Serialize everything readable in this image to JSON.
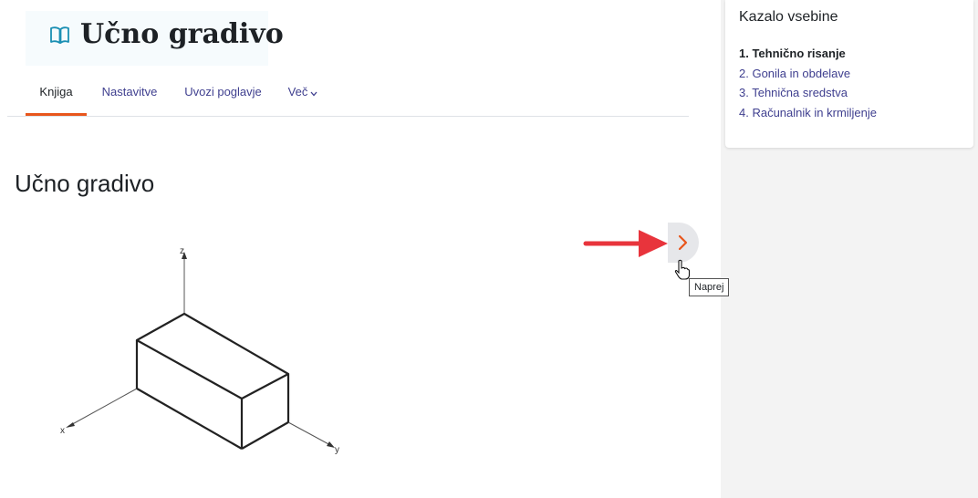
{
  "header": {
    "title": "Učno gradivo",
    "icon": "book-open-icon"
  },
  "tabs": [
    {
      "label": "Knjiga",
      "active": true
    },
    {
      "label": "Nastavitve",
      "active": false
    },
    {
      "label": "Uvozi poglavje",
      "active": false
    },
    {
      "label": "Več",
      "active": false
    }
  ],
  "content": {
    "title": "Učno gradivo",
    "figure_axis_labels": {
      "z": "z",
      "x": "x",
      "y": "y"
    }
  },
  "toc": {
    "title": "Kazalo vsebine",
    "items": [
      {
        "label": "1. Tehnično risanje",
        "active": true
      },
      {
        "label": "2. Gonila in obdelave",
        "active": false
      },
      {
        "label": "3. Tehnična sredstva",
        "active": false
      },
      {
        "label": "4. Računalnik in krmiljenje",
        "active": false
      }
    ]
  },
  "next_button": {
    "tooltip": "Naprej"
  },
  "colors": {
    "accent": "#e8561c",
    "link": "#3f3f8f",
    "annotation_arrow": "#e8343c"
  }
}
